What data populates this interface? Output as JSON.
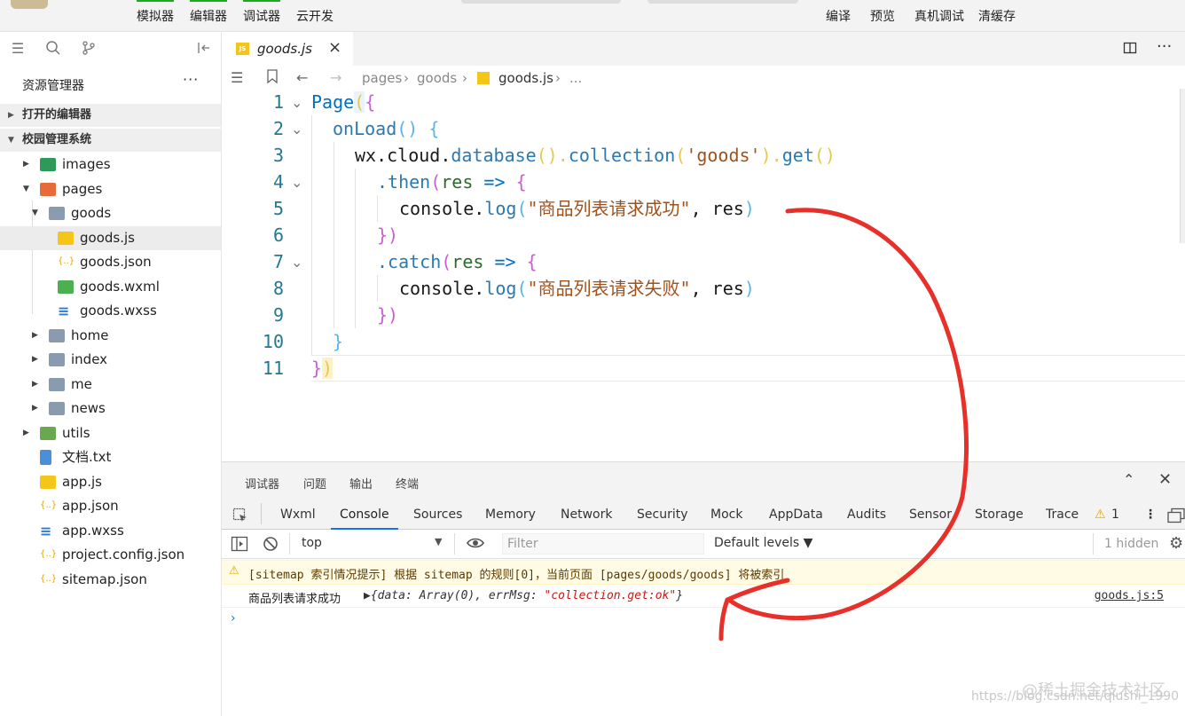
{
  "topbar": {
    "tools": [
      "模拟器",
      "编辑器",
      "调试器",
      "云开发"
    ],
    "right_tools": [
      "编译",
      "预览",
      "真机调试",
      "清缓存"
    ]
  },
  "sidebar": {
    "title": "资源管理器",
    "more": "···",
    "sections": [
      "打开的编辑器",
      "校园管理系统"
    ],
    "tree": [
      {
        "label": "images",
        "icon": "image-folder-icon"
      },
      {
        "label": "pages",
        "icon": "pages-folder-icon"
      },
      {
        "label": "goods",
        "icon": "folder-open-icon"
      },
      {
        "label": "goods.js",
        "icon": "js-file-icon"
      },
      {
        "label": "goods.json",
        "icon": "json-file-icon"
      },
      {
        "label": "goods.wxml",
        "icon": "wxml-file-icon"
      },
      {
        "label": "goods.wxss",
        "icon": "wxss-file-icon"
      },
      {
        "label": "home",
        "icon": "folder-icon"
      },
      {
        "label": "index",
        "icon": "folder-icon"
      },
      {
        "label": "me",
        "icon": "folder-icon"
      },
      {
        "label": "news",
        "icon": "folder-icon"
      },
      {
        "label": "utils",
        "icon": "utils-folder-icon"
      },
      {
        "label": "文档.txt",
        "icon": "txt-file-icon"
      },
      {
        "label": "app.js",
        "icon": "js-file-icon"
      },
      {
        "label": "app.json",
        "icon": "json-file-icon"
      },
      {
        "label": "app.wxss",
        "icon": "wxss-file-icon"
      },
      {
        "label": "project.config.json",
        "icon": "json-file-icon"
      },
      {
        "label": "sitemap.json",
        "icon": "json-file-icon"
      }
    ]
  },
  "editor": {
    "tab": {
      "name": "goods.js",
      "icon_text": "JS"
    },
    "breadcrumb": [
      "pages",
      "goods",
      "goods.js",
      "..."
    ],
    "lines": [
      {
        "n": "1",
        "fold": true
      },
      {
        "n": "2",
        "fold": true
      },
      {
        "n": "3",
        "fold": false
      },
      {
        "n": "4",
        "fold": true
      },
      {
        "n": "5",
        "fold": false
      },
      {
        "n": "6",
        "fold": false
      },
      {
        "n": "7",
        "fold": true
      },
      {
        "n": "8",
        "fold": false
      },
      {
        "n": "9",
        "fold": false
      },
      {
        "n": "10",
        "fold": false
      },
      {
        "n": "11",
        "fold": false
      }
    ],
    "code": {
      "l1": {
        "a": "Page",
        "b": "(",
        "c": "{"
      },
      "l2": {
        "a": "onLoad",
        "b": "()",
        "c": " {"
      },
      "l3": {
        "a": "wx",
        "b": ".cloud.",
        "c": "database",
        "d": "().",
        "e": "collection",
        "f": "(",
        "g": "'goods'",
        "h": ").",
        "i": "get",
        "j": "()"
      },
      "l4": {
        "a": ".then",
        "b": "(",
        "c": "res",
        "d": " => ",
        "e": "{"
      },
      "l5": {
        "a": "console.",
        "b": "log",
        "c": "(",
        "d": "\"商品列表请求成功\"",
        "e": ", res",
        "f": ")"
      },
      "l6": {
        "a": "}",
        "b": ")"
      },
      "l7": {
        "a": ".catch",
        "b": "(",
        "c": "res",
        "d": " => ",
        "e": "{"
      },
      "l8": {
        "a": "console.",
        "b": "log",
        "c": "(",
        "d": "\"商品列表请求失败\"",
        "e": ", res",
        "f": ")"
      },
      "l9": {
        "a": "}",
        "b": ")"
      },
      "l10": {
        "a": "}"
      },
      "l11": {
        "a": "}",
        "b": ")"
      }
    }
  },
  "devtools": {
    "top_tabs": [
      "调试器",
      "问题",
      "输出",
      "终端"
    ],
    "panels": [
      "Wxml",
      "Console",
      "Sources",
      "Memory",
      "Network",
      "Security",
      "Mock",
      "AppData",
      "Audits",
      "Sensor",
      "Storage",
      "Trace"
    ],
    "active_panel": "Console",
    "warning_count": "1",
    "context": "top",
    "filter_placeholder": "Filter",
    "levels": "Default levels ▼",
    "hidden": "1 hidden",
    "warning_message": "[sitemap 索引情况提示] 根据 sitemap 的规则[0]，当前页面 [pages/goods/goods] 将被索引",
    "log": {
      "label": "商品列表请求成功",
      "object_prefix": "▶{data: Array(0), errMsg: ",
      "errmsg": "\"collection.get:ok\"",
      "object_suffix": "}",
      "source": "goods.js:5"
    },
    "prompt": "›"
  },
  "watermark": {
    "line1": "@稀土掘金技术社区",
    "line2": "https://blog.csdn.net/qiushi_1990"
  }
}
